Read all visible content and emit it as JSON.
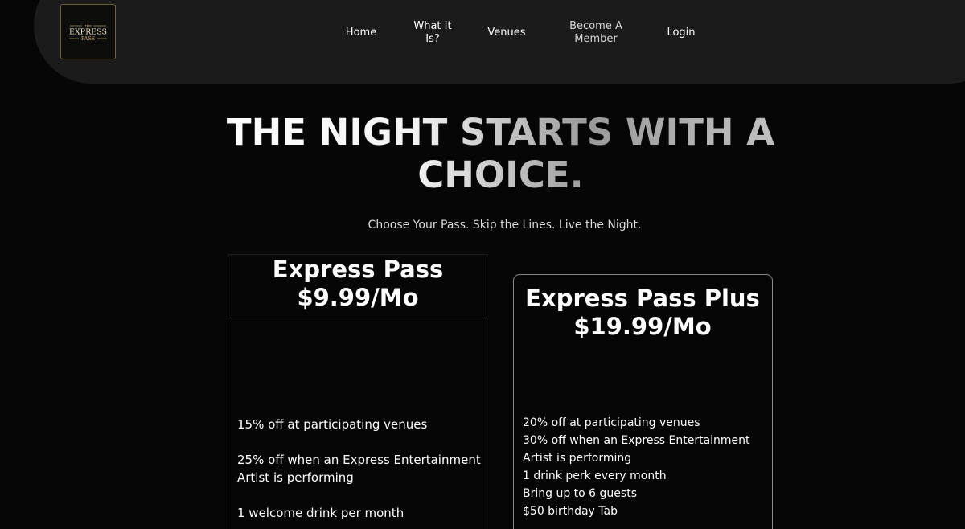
{
  "brand": {
    "logo_top": "THE",
    "logo_main": "EXPRESS",
    "logo_bottom": "PASS"
  },
  "nav": {
    "home": "Home",
    "what_line1": "What It",
    "what_line2": "Is?",
    "venues": "Venues",
    "member_line1": "Become A",
    "member_line2": "Member",
    "login": "Login"
  },
  "hero": {
    "title_line1": "THE NIGHT STARTS WITH A",
    "title_line2": "CHOICE.",
    "subtitle": "Choose Your Pass. Skip the Lines. Live the Night."
  },
  "plans": {
    "basic": {
      "name": "Express Pass",
      "price": "$9.99/Mo",
      "features": [
        "15% off at participating venues",
        "25% off when an Express Entertainment Artist is performing",
        "1 welcome drink per month"
      ]
    },
    "plus": {
      "name": "Express Pass Plus",
      "price": "$19.99/Mo",
      "features": [
        "20% off at participating venues",
        "30% off when an Express Entertainment Artist is performing",
        "1 drink perk every month",
        "Bring up to 6 guests",
        "$50 birthday Tab"
      ]
    }
  },
  "colors": {
    "background": "#060606",
    "header": "#1b1b1b",
    "logo_gold": "#c9b37a",
    "card_border": "#8a8a8a"
  }
}
